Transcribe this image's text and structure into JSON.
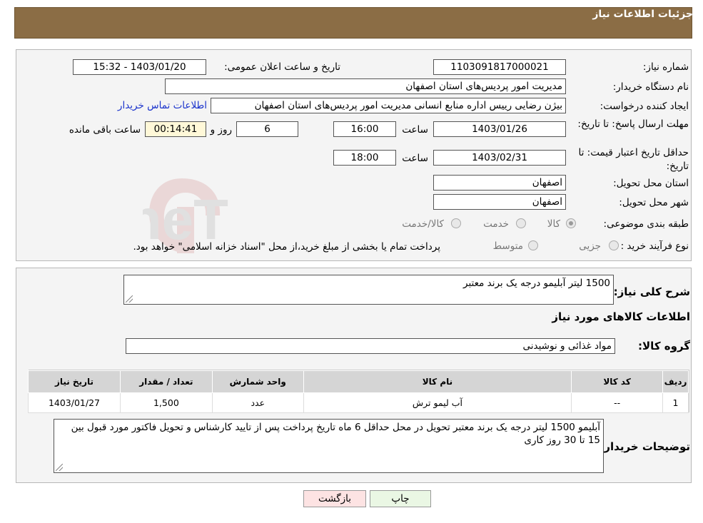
{
  "header": {
    "title": "جزئیات اطلاعات نیاز"
  },
  "watermark": {
    "text": "AriaTender.neT"
  },
  "need": {
    "number_label": "شماره نیاز:",
    "number_value": "1103091817000021",
    "announce_label": "تاریخ و ساعت اعلان عمومی:",
    "announce_value": "1403/01/20 - 15:32",
    "buyer_org_label": "نام دستگاه خریدار:",
    "buyer_org_value": "مدیریت امور پردیس‌های استان اصفهان",
    "creator_label": "ایجاد کننده درخواست:",
    "creator_value": "بیژن  رضایی رییس اداره منابع انسانی مدیریت امور پردیس‌های استان اصفهان",
    "contact_link": "اطلاعات تماس خریدار",
    "reply_deadline_label": "مهلت ارسال پاسخ: تا تاریخ:",
    "reply_date": "1403/01/26",
    "time_word": "ساعت",
    "reply_time": "16:00",
    "days_value": "6",
    "days_word": "روز و",
    "remaining_value": "00:14:41",
    "remaining_word": "ساعت باقی مانده",
    "price_validity_label": "حداقل تاریخ اعتبار قیمت: تا تاریخ:",
    "price_date": "1403/02/31",
    "price_time": "18:00",
    "province_label": "استان محل تحویل:",
    "province_value": "اصفهان",
    "city_label": "شهر محل تحویل:",
    "city_value": "اصفهان",
    "category_label": "طبقه بندی موضوعی:",
    "category_options": [
      "کالا",
      "خدمت",
      "کالا/خدمت"
    ],
    "process_label": "نوع فرآیند خرید :",
    "process_options": [
      "جزیی",
      "متوسط"
    ],
    "process_note": "پرداخت تمام یا بخشی از مبلغ خرید،از محل \"اسناد خزانه اسلامی\" خواهد بود."
  },
  "details": {
    "summary_label": "شرح کلی نیاز:",
    "summary_value": "1500 لیتر آبلیمو درجه یک برند معتبر",
    "goods_info_label": "اطلاعات کالاهای مورد نیاز",
    "goods_group_label": "گروه کالا:",
    "goods_group_value": "مواد غذائی و نوشیدنی",
    "table": {
      "headers": [
        "ردیف",
        "کد کالا",
        "نام کالا",
        "واحد شمارش",
        "تعداد / مقدار",
        "تاریخ نیاز"
      ],
      "rows": [
        [
          "1",
          "--",
          "آب لیمو ترش",
          "عدد",
          "1,500",
          "1403/01/27"
        ]
      ]
    },
    "buyer_notes_label": "توضیحات خریدار:",
    "buyer_notes_value": "آبلیمو 1500 لیتر درجه یک برند معتبر  تحویل در محل حداقل 6 ماه تاریخ پرداخت پس از تایید کارشناس و تحویل فاکتور مورد قبول بین 15 تا 30 روز کاری"
  },
  "actions": {
    "print_label": "چاپ",
    "back_label": "بازگشت"
  }
}
